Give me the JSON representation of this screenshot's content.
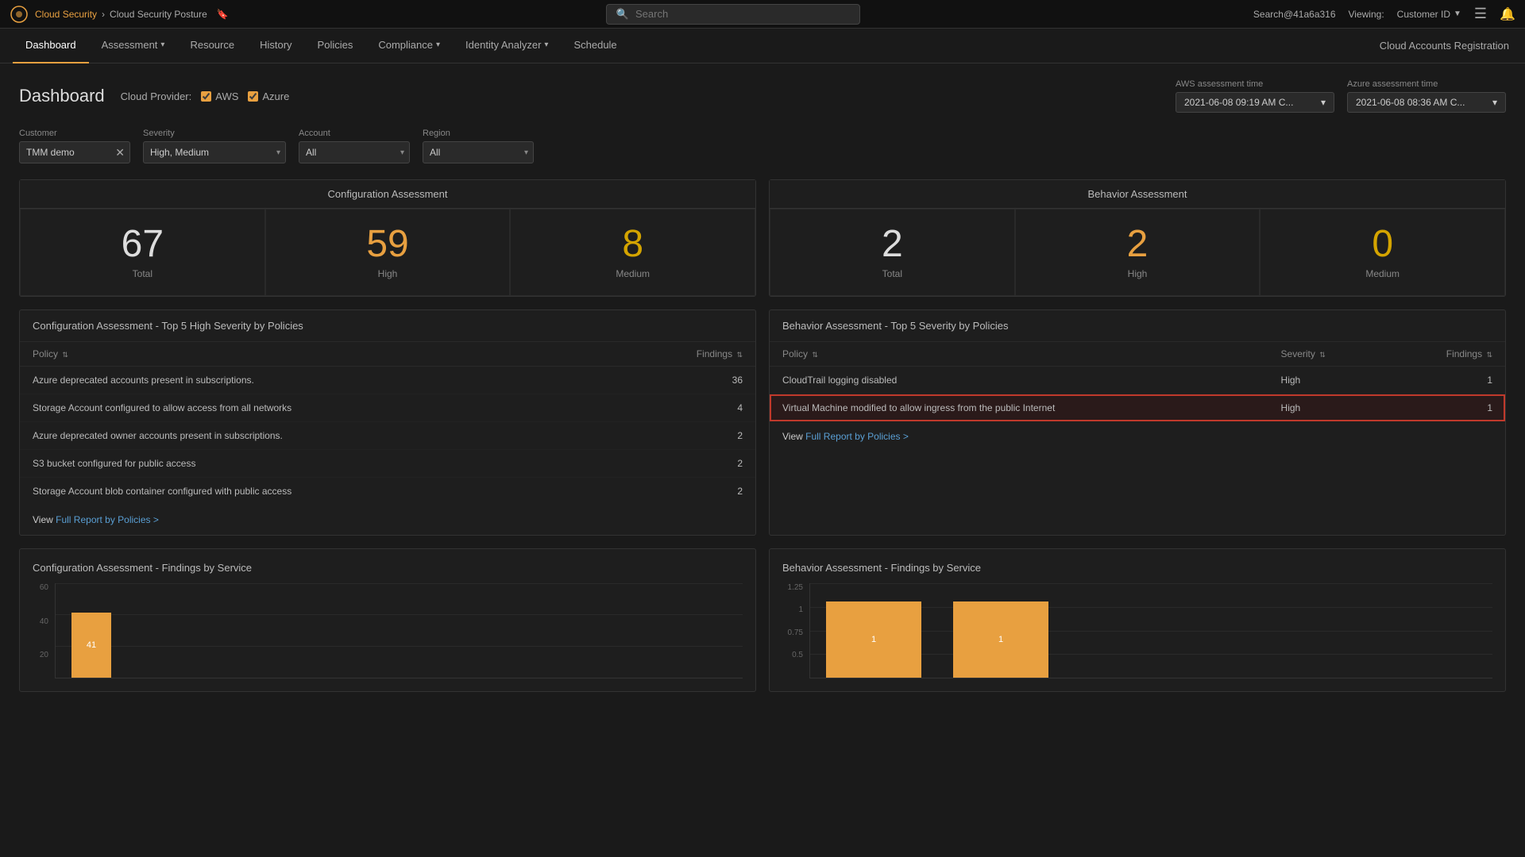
{
  "topbar": {
    "logo_alt": "app-logo",
    "breadcrumb": {
      "root": "Cloud Security",
      "separator": ">",
      "current": "Cloud Security Posture"
    },
    "search_placeholder": "Search",
    "user": "Search@41a6a316",
    "viewing_label": "Viewing:",
    "customer_id": "Customer ID",
    "cloud_accounts": "Cloud Accounts Registration"
  },
  "nav": {
    "items": [
      {
        "label": "Dashboard",
        "active": true,
        "dropdown": false
      },
      {
        "label": "Assessment",
        "active": false,
        "dropdown": true
      },
      {
        "label": "Resource",
        "active": false,
        "dropdown": false
      },
      {
        "label": "History",
        "active": false,
        "dropdown": false
      },
      {
        "label": "Policies",
        "active": false,
        "dropdown": false
      },
      {
        "label": "Compliance",
        "active": false,
        "dropdown": true
      },
      {
        "label": "Identity Analyzer",
        "active": false,
        "dropdown": true
      },
      {
        "label": "Schedule",
        "active": false,
        "dropdown": false
      }
    ]
  },
  "page": {
    "title": "Dashboard",
    "cloud_provider_label": "Cloud Provider:",
    "aws_label": "AWS",
    "azure_label": "Azure",
    "aws_checked": true,
    "azure_checked": true
  },
  "assessment_times": {
    "aws_label": "AWS assessment time",
    "aws_value": "2021-06-08 09:19 AM C...",
    "azure_label": "Azure assessment time",
    "azure_value": "2021-06-08 08:36 AM C..."
  },
  "filters": {
    "customer_label": "Customer",
    "customer_value": "TMM demo",
    "severity_label": "Severity",
    "severity_value": "High, Medium",
    "account_label": "Account",
    "account_value": "All",
    "region_label": "Region",
    "region_value": "All"
  },
  "config_assessment": {
    "panel_title": "Configuration Assessment",
    "stats": [
      {
        "value": "67",
        "label": "Total",
        "color": "white"
      },
      {
        "value": "59",
        "label": "High",
        "color": "orange"
      },
      {
        "value": "8",
        "label": "Medium",
        "color": "yellow"
      }
    ],
    "table_title": "Configuration Assessment - Top 5 High Severity by Policies",
    "policy_col": "Policy",
    "findings_col": "Findings",
    "rows": [
      {
        "policy": "Azure deprecated accounts present in subscriptions.",
        "findings": "36"
      },
      {
        "policy": "Storage Account configured to allow access from all networks",
        "findings": "4"
      },
      {
        "policy": "Azure deprecated owner accounts present in subscriptions.",
        "findings": "2"
      },
      {
        "policy": "S3 bucket configured for public access",
        "findings": "2"
      },
      {
        "policy": "Storage Account blob container configured with public access",
        "findings": "2"
      }
    ],
    "view_link": "Full Report by Policies >",
    "chart_title": "Configuration Assessment - Findings by Service",
    "chart_y_labels": [
      "60",
      "40",
      "20"
    ],
    "chart_bar_value": "41"
  },
  "behavior_assessment": {
    "panel_title": "Behavior Assessment",
    "stats": [
      {
        "value": "2",
        "label": "Total",
        "color": "white"
      },
      {
        "value": "2",
        "label": "High",
        "color": "orange"
      },
      {
        "value": "0",
        "label": "Medium",
        "color": "yellow"
      }
    ],
    "table_title": "Behavior Assessment - Top 5 Severity by Policies",
    "policy_col": "Policy",
    "severity_col": "Severity",
    "findings_col": "Findings",
    "rows": [
      {
        "policy": "CloudTrail logging disabled",
        "severity": "High",
        "findings": "1",
        "selected": false
      },
      {
        "policy": "Virtual Machine modified to allow ingress from the public Internet",
        "severity": "High",
        "findings": "1",
        "selected": true
      }
    ],
    "view_link": "Full Report by Policies >",
    "chart_title": "Behavior Assessment - Findings by Service",
    "chart_y_labels": [
      "1.25",
      "1",
      "0.75",
      "0.5"
    ],
    "chart_bars": [
      {
        "value": "1",
        "height": 80
      },
      {
        "value": "1",
        "height": 80
      }
    ]
  }
}
